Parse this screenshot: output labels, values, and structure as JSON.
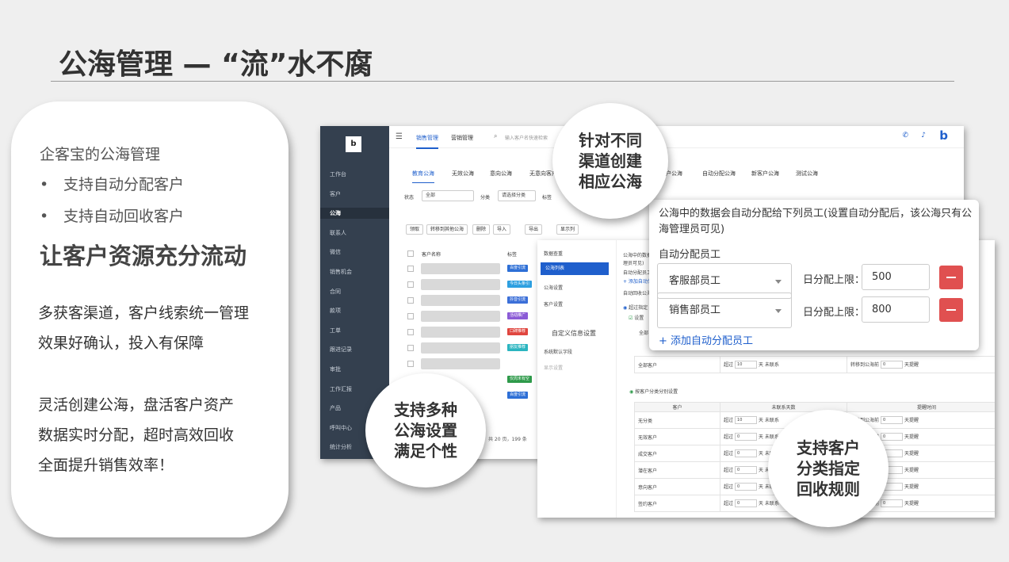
{
  "title": "公海管理 — “流”水不腐",
  "left": {
    "subtitle": "企客宝的公海管理",
    "bullet": "•",
    "b1": "支持自动分配客户",
    "b2": "支持自动回收客户",
    "headline": "让客户资源充分流动",
    "p1a": "多获客渠道，客户线索统一管理",
    "p1b": "效果好确认，投入有保障",
    "p2a": "灵活创建公海，盘活客户资产",
    "p2b": "数据实时分配，超时高效回收",
    "p2c": "全面提升销售效率！"
  },
  "circles": {
    "c1a": "针对不同",
    "c1b": "渠道创建",
    "c1c": "相应公海",
    "c2a": "支持多种",
    "c2b": "公海设置",
    "c2c": "满足个性",
    "c3a": "支持客户",
    "c3b": "分类指定",
    "c3c": "回收规则"
  },
  "app": {
    "logo": "企客宝",
    "nav": [
      "工作台",
      "客户",
      "公海",
      "联系人",
      "微信",
      "销售机会",
      "合同",
      "款项",
      "工单",
      "跟进记录",
      "审批",
      "工作汇报",
      "产品",
      "呼叫中心",
      "统计分析"
    ],
    "tabs": [
      "销售管理",
      "营销管理"
    ],
    "search_placeholder": "输入客户名快速检索",
    "pool_tabs": [
      "教育公海",
      "无效公海",
      "意向公海",
      "无意向客户",
      "户公海",
      "自动分配公海",
      "新客户公海",
      "测试公海"
    ],
    "filter_status": "状态",
    "filter_all": "全部",
    "filter_cat": "分类",
    "filter_cat_ph": "请选择分类",
    "filter_tag": "标签",
    "buttons": [
      "领取",
      "转移到其他公海",
      "删除",
      "导入",
      "导出",
      "显示列"
    ],
    "col_name": "客户名称",
    "col_tag": "标签",
    "tags": [
      {
        "t": "百度引流",
        "c": "#2d6fd6"
      },
      {
        "t": "今日头条引",
        "c": "#2d9fe0"
      },
      {
        "t": "抖音引流",
        "c": "#3b6fd8"
      },
      {
        "t": "活动推广",
        "c": "#8b5bd6"
      },
      {
        "t": "口碑推荐",
        "c": "#e0463f"
      },
      {
        "t": "朋友推荐",
        "c": "#2bb5c0"
      },
      {
        "t": "",
        "c": "#fff"
      },
      {
        "t": "仅周末有空",
        "c": "#2e9a4a"
      },
      {
        "t": "百度引流",
        "c": "#2d6fd6"
      }
    ],
    "pager": "共 20 页，199 条"
  },
  "settings": {
    "menu": [
      "数据查重",
      "公海列表",
      "公海设置",
      "客户设置",
      "自定义信息设置",
      "系统默认字段",
      "显示设置"
    ],
    "desc1": "公海中的数据",
    "desc2": "理员可见)",
    "desc3": "自动分配员工",
    "desc4": "+ 添加自动分",
    "desc5": "自动回收公海",
    "desc6": "超过指定",
    "desc7": "设置",
    "desc8": "全部",
    "all_row": "全部客户",
    "over": "超过",
    "days_val": "10",
    "no_contact": "天 未联系",
    "transfer": "转移到公海前",
    "zero": "0",
    "remind": "天提醒",
    "by_cat": "按客户分类分别设置",
    "h_cust": "客户",
    "h_days": "未联系天数",
    "h_remind": "提醒时间",
    "rows": [
      {
        "n": "无分类",
        "d": "10"
      },
      {
        "n": "无效客户",
        "d": "0"
      },
      {
        "n": "成交客户",
        "d": "0"
      },
      {
        "n": "潜在客户",
        "d": "0"
      },
      {
        "n": "意向客户",
        "d": "0"
      },
      {
        "n": "签约客户",
        "d": "0"
      }
    ]
  },
  "popup": {
    "desc": "公海中的数据会自动分配给下列员工(设置自动分配后，该公海只有公海管理员可见)",
    "label": "自动分配员工",
    "dept1": "客服部员工",
    "dept2": "销售部员工",
    "limit": "日分配上限：",
    "n1": "500",
    "n2": "800",
    "add": "+ 添加自动分配员工"
  }
}
